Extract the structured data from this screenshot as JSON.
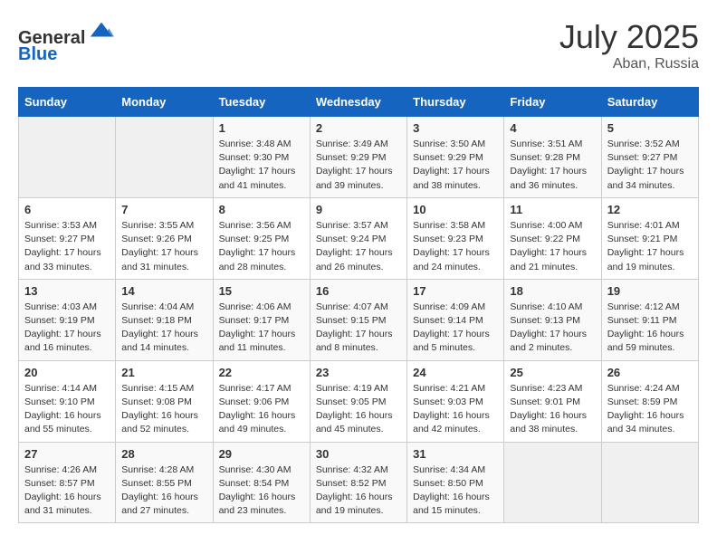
{
  "header": {
    "logo_line1": "General",
    "logo_line2": "Blue",
    "month_year": "July 2025",
    "location": "Aban, Russia"
  },
  "days_of_week": [
    "Sunday",
    "Monday",
    "Tuesday",
    "Wednesday",
    "Thursday",
    "Friday",
    "Saturday"
  ],
  "weeks": [
    [
      {
        "day": "",
        "content": ""
      },
      {
        "day": "",
        "content": ""
      },
      {
        "day": "1",
        "content": "Sunrise: 3:48 AM\nSunset: 9:30 PM\nDaylight: 17 hours and 41 minutes."
      },
      {
        "day": "2",
        "content": "Sunrise: 3:49 AM\nSunset: 9:29 PM\nDaylight: 17 hours and 39 minutes."
      },
      {
        "day": "3",
        "content": "Sunrise: 3:50 AM\nSunset: 9:29 PM\nDaylight: 17 hours and 38 minutes."
      },
      {
        "day": "4",
        "content": "Sunrise: 3:51 AM\nSunset: 9:28 PM\nDaylight: 17 hours and 36 minutes."
      },
      {
        "day": "5",
        "content": "Sunrise: 3:52 AM\nSunset: 9:27 PM\nDaylight: 17 hours and 34 minutes."
      }
    ],
    [
      {
        "day": "6",
        "content": "Sunrise: 3:53 AM\nSunset: 9:27 PM\nDaylight: 17 hours and 33 minutes."
      },
      {
        "day": "7",
        "content": "Sunrise: 3:55 AM\nSunset: 9:26 PM\nDaylight: 17 hours and 31 minutes."
      },
      {
        "day": "8",
        "content": "Sunrise: 3:56 AM\nSunset: 9:25 PM\nDaylight: 17 hours and 28 minutes."
      },
      {
        "day": "9",
        "content": "Sunrise: 3:57 AM\nSunset: 9:24 PM\nDaylight: 17 hours and 26 minutes."
      },
      {
        "day": "10",
        "content": "Sunrise: 3:58 AM\nSunset: 9:23 PM\nDaylight: 17 hours and 24 minutes."
      },
      {
        "day": "11",
        "content": "Sunrise: 4:00 AM\nSunset: 9:22 PM\nDaylight: 17 hours and 21 minutes."
      },
      {
        "day": "12",
        "content": "Sunrise: 4:01 AM\nSunset: 9:21 PM\nDaylight: 17 hours and 19 minutes."
      }
    ],
    [
      {
        "day": "13",
        "content": "Sunrise: 4:03 AM\nSunset: 9:19 PM\nDaylight: 17 hours and 16 minutes."
      },
      {
        "day": "14",
        "content": "Sunrise: 4:04 AM\nSunset: 9:18 PM\nDaylight: 17 hours and 14 minutes."
      },
      {
        "day": "15",
        "content": "Sunrise: 4:06 AM\nSunset: 9:17 PM\nDaylight: 17 hours and 11 minutes."
      },
      {
        "day": "16",
        "content": "Sunrise: 4:07 AM\nSunset: 9:15 PM\nDaylight: 17 hours and 8 minutes."
      },
      {
        "day": "17",
        "content": "Sunrise: 4:09 AM\nSunset: 9:14 PM\nDaylight: 17 hours and 5 minutes."
      },
      {
        "day": "18",
        "content": "Sunrise: 4:10 AM\nSunset: 9:13 PM\nDaylight: 17 hours and 2 minutes."
      },
      {
        "day": "19",
        "content": "Sunrise: 4:12 AM\nSunset: 9:11 PM\nDaylight: 16 hours and 59 minutes."
      }
    ],
    [
      {
        "day": "20",
        "content": "Sunrise: 4:14 AM\nSunset: 9:10 PM\nDaylight: 16 hours and 55 minutes."
      },
      {
        "day": "21",
        "content": "Sunrise: 4:15 AM\nSunset: 9:08 PM\nDaylight: 16 hours and 52 minutes."
      },
      {
        "day": "22",
        "content": "Sunrise: 4:17 AM\nSunset: 9:06 PM\nDaylight: 16 hours and 49 minutes."
      },
      {
        "day": "23",
        "content": "Sunrise: 4:19 AM\nSunset: 9:05 PM\nDaylight: 16 hours and 45 minutes."
      },
      {
        "day": "24",
        "content": "Sunrise: 4:21 AM\nSunset: 9:03 PM\nDaylight: 16 hours and 42 minutes."
      },
      {
        "day": "25",
        "content": "Sunrise: 4:23 AM\nSunset: 9:01 PM\nDaylight: 16 hours and 38 minutes."
      },
      {
        "day": "26",
        "content": "Sunrise: 4:24 AM\nSunset: 8:59 PM\nDaylight: 16 hours and 34 minutes."
      }
    ],
    [
      {
        "day": "27",
        "content": "Sunrise: 4:26 AM\nSunset: 8:57 PM\nDaylight: 16 hours and 31 minutes."
      },
      {
        "day": "28",
        "content": "Sunrise: 4:28 AM\nSunset: 8:55 PM\nDaylight: 16 hours and 27 minutes."
      },
      {
        "day": "29",
        "content": "Sunrise: 4:30 AM\nSunset: 8:54 PM\nDaylight: 16 hours and 23 minutes."
      },
      {
        "day": "30",
        "content": "Sunrise: 4:32 AM\nSunset: 8:52 PM\nDaylight: 16 hours and 19 minutes."
      },
      {
        "day": "31",
        "content": "Sunrise: 4:34 AM\nSunset: 8:50 PM\nDaylight: 16 hours and 15 minutes."
      },
      {
        "day": "",
        "content": ""
      },
      {
        "day": "",
        "content": ""
      }
    ]
  ]
}
